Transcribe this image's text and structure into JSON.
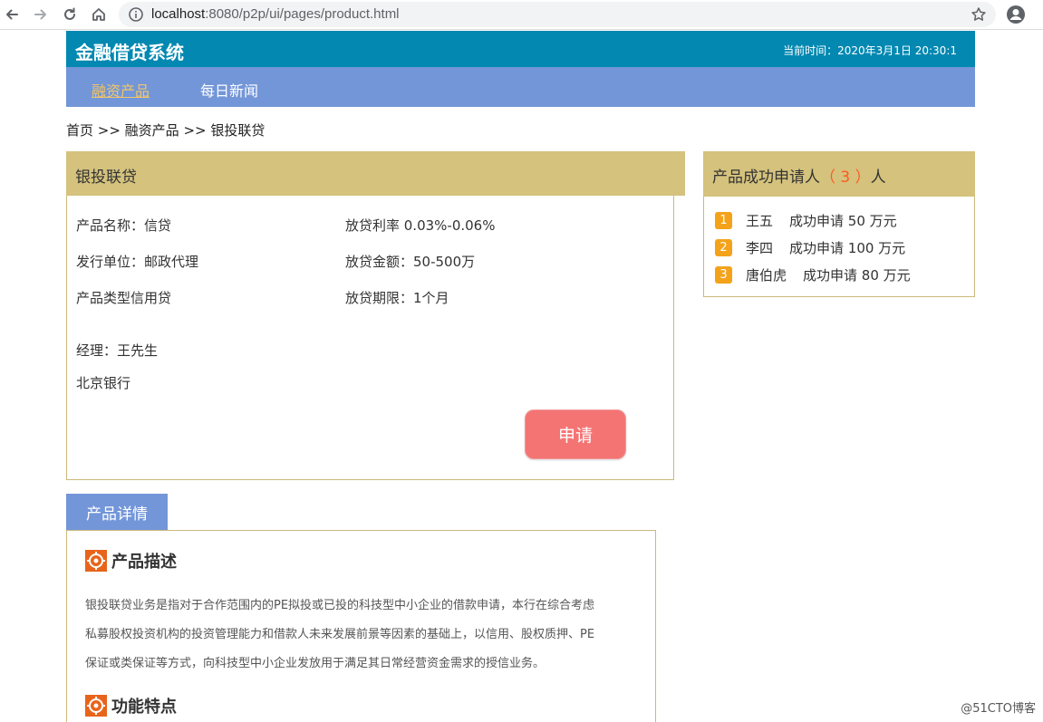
{
  "browser": {
    "url_host": "localhost",
    "url_rest": ":8080/p2p/ui/pages/product.html",
    "icons": [
      "back-icon",
      "forward-icon",
      "reload-icon",
      "home-icon",
      "info-icon",
      "star-icon",
      "account-icon"
    ]
  },
  "header": {
    "title": "金融借贷系统",
    "time": "当前时间：2020年3月1日 20:30:1"
  },
  "nav": {
    "items": [
      {
        "label": "融资产品",
        "active": true
      },
      {
        "label": "每日新闻",
        "active": false
      }
    ]
  },
  "breadcrumb": "首页 >> 融资产品 >> 银投联贷",
  "product": {
    "title": "银投联贷",
    "name": "产品名称：信贷",
    "rate": "放贷利率 0.03%-0.06%",
    "issuer": "发行单位：邮政代理",
    "amount": "放贷金额：50-500万",
    "type": "产品类型信用贷",
    "term": "放贷期限：1个月",
    "manager": "经理：王先生",
    "bank": "北京银行",
    "apply_label": "申请"
  },
  "applicants": {
    "title_prefix": "产品成功申请人",
    "count": "（ 3 ）",
    "title_suffix": "人",
    "items": [
      {
        "rank": "1",
        "name": "王五",
        "text": "成功申请 50 万元"
      },
      {
        "rank": "2",
        "name": "李四",
        "text": "成功申请 100 万元"
      },
      {
        "rank": "3",
        "name": "唐伯虎",
        "text": "成功申请 80 万元"
      }
    ]
  },
  "details": {
    "tab_label": "产品详情",
    "desc_title": "产品描述",
    "desc_lines": [
      "银投联贷业务是指对于合作范围内的PE拟投或已投的科技型中小企业的借款申请，本行在综合考虑",
      "私募股权投资机构的投资管理能力和借款人未来发展前景等因素的基础上，以信用、股权质押、PE",
      "保证或类保证等方式，向科技型中小企业发放用于满足其日常经营资金需求的授信业务。"
    ],
    "feature_title": "功能特点"
  },
  "watermark": "@51CTO博客",
  "colors": {
    "header_bg": "#0288b1",
    "nav_bg": "#7396d8",
    "nav_active": "#f0c568",
    "panel_head_bg": "#d4c27d",
    "apply_btn": "#f47474",
    "rank_badge": "#f4a21a",
    "count_text": "#ff5a1f"
  }
}
